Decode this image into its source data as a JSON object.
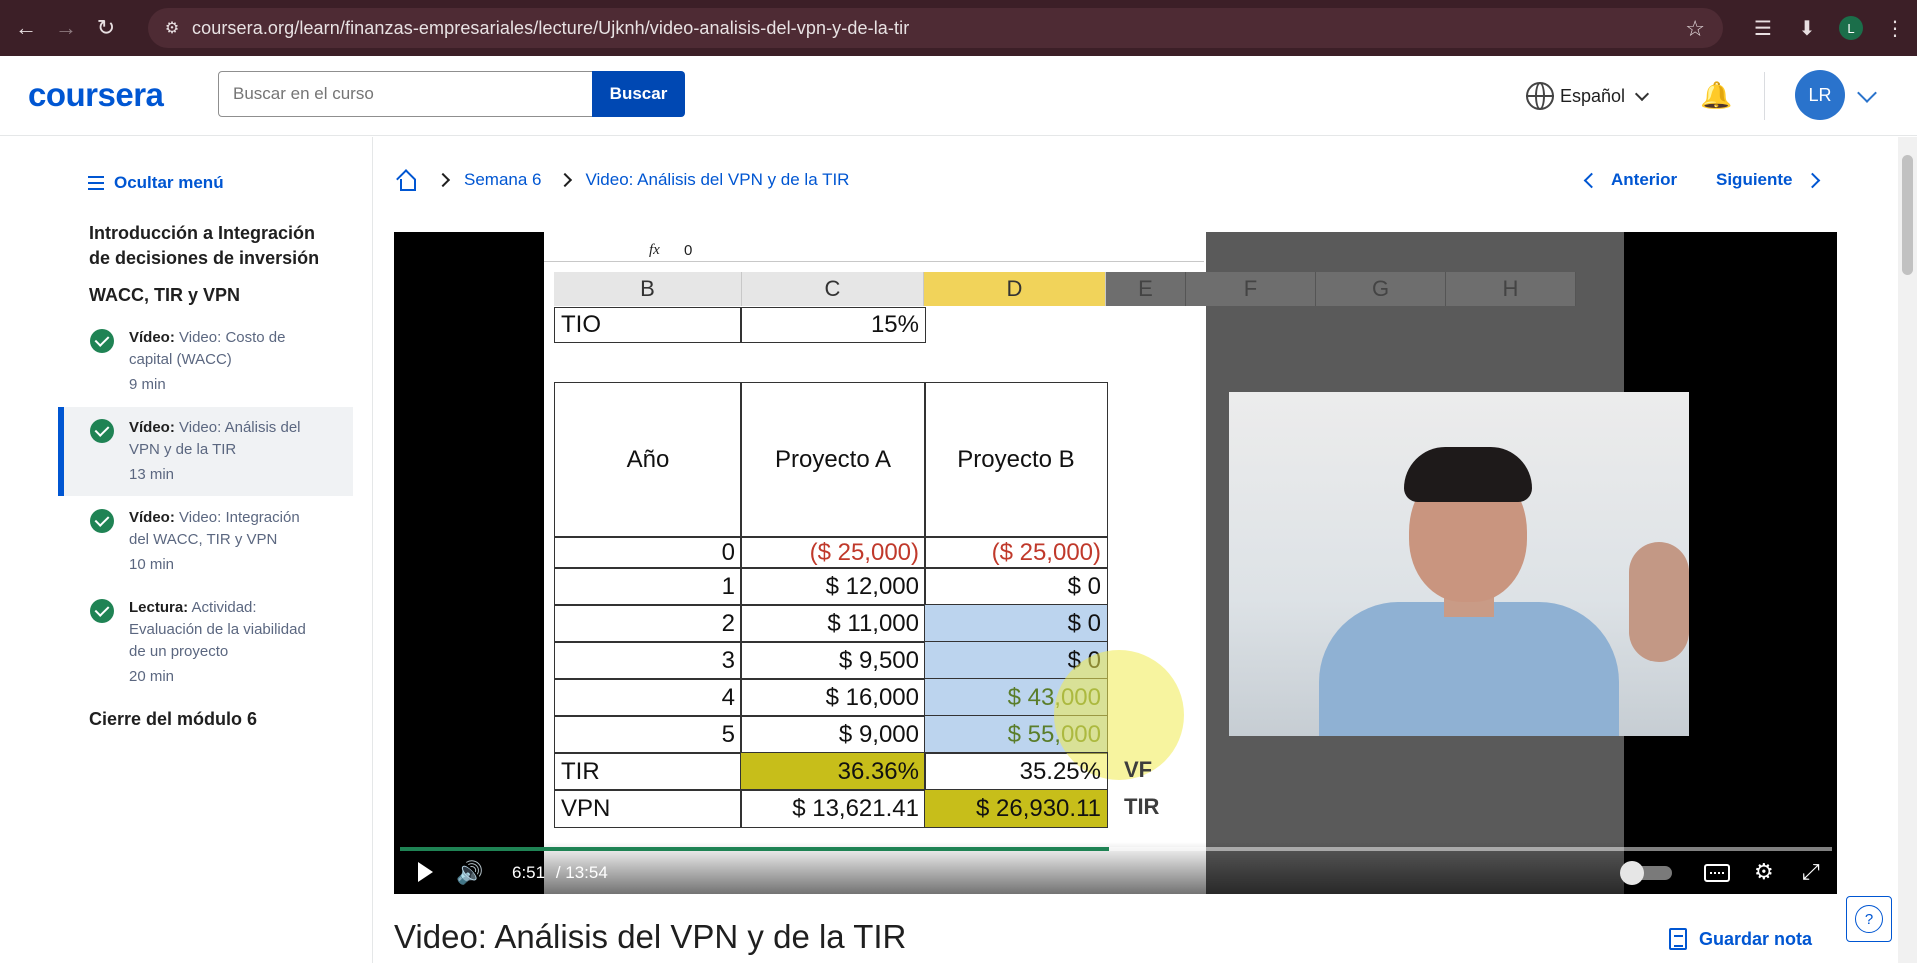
{
  "browser": {
    "url": "coursera.org/learn/finanzas-empresariales/lecture/Ujknh/video-analisis-del-vpn-y-de-la-tir",
    "profile_initial": "L"
  },
  "header": {
    "logo": "coursera",
    "search_placeholder": "Buscar en el curso",
    "search_button": "Buscar",
    "language": "Español",
    "avatar_initials": "LR"
  },
  "sidebar": {
    "hide_menu": "Ocultar menú",
    "module_title": "Introducción a Integración de decisiones de inversión",
    "section_title": "WACC, TIR y VPN",
    "items": [
      {
        "type": "Vídeo:",
        "title": "Video: Costo de capital (WACC)",
        "duration": "9 min",
        "completed": true,
        "active": false
      },
      {
        "type": "Vídeo:",
        "title": "Video: Análisis del VPN y de la TIR",
        "duration": "13 min",
        "completed": true,
        "active": true
      },
      {
        "type": "Vídeo:",
        "title": "Video: Integración del WACC, TIR y VPN",
        "duration": "10 min",
        "completed": true,
        "active": false
      },
      {
        "type": "Lectura:",
        "title": "Actividad: Evaluación de la viabilidad de un proyecto",
        "duration": "20 min",
        "completed": true,
        "active": false
      }
    ],
    "closure": "Cierre del módulo 6"
  },
  "breadcrumb": {
    "week": "Semana 6",
    "current": "Video: Análisis del VPN y de la TIR"
  },
  "pager": {
    "prev": "Anterior",
    "next": "Siguiente"
  },
  "video": {
    "time_current": "6:51",
    "time_total": "/ 13:54",
    "progress": 0.495,
    "spreadsheet": {
      "formula_fx": "fx",
      "formula_value": "0",
      "columns": [
        "B",
        "C",
        "D",
        "E",
        "F",
        "G",
        "H"
      ],
      "tio_label": "TIO",
      "tio_value": "15%",
      "headers": [
        "Año",
        "Proyecto A",
        "Proyecto B"
      ],
      "rows": [
        {
          "year": "0",
          "a": "($ 25,000)",
          "b": "($ 25,000)"
        },
        {
          "year": "1",
          "a": "$ 12,000",
          "b": "$ 0"
        },
        {
          "year": "2",
          "a": "$ 11,000",
          "b": "$ 0"
        },
        {
          "year": "3",
          "a": "$ 9,500",
          "b": "$ 0"
        },
        {
          "year": "4",
          "a": "$ 16,000",
          "b": "$ 43,000"
        },
        {
          "year": "5",
          "a": "$ 9,000",
          "b": "$ 55,000"
        }
      ],
      "tir_label": "TIR",
      "tir_a": "36.36%",
      "tir_b": "35.25%",
      "vpn_label": "VPN",
      "vpn_a": "$ 13,621.41",
      "vpn_b": "$ 26,930.11",
      "side_labels": [
        "VF",
        "TIR"
      ]
    }
  },
  "content": {
    "video_title": "Video: Análisis del VPN y de la TIR",
    "save_note": "Guardar nota",
    "help": "?"
  }
}
